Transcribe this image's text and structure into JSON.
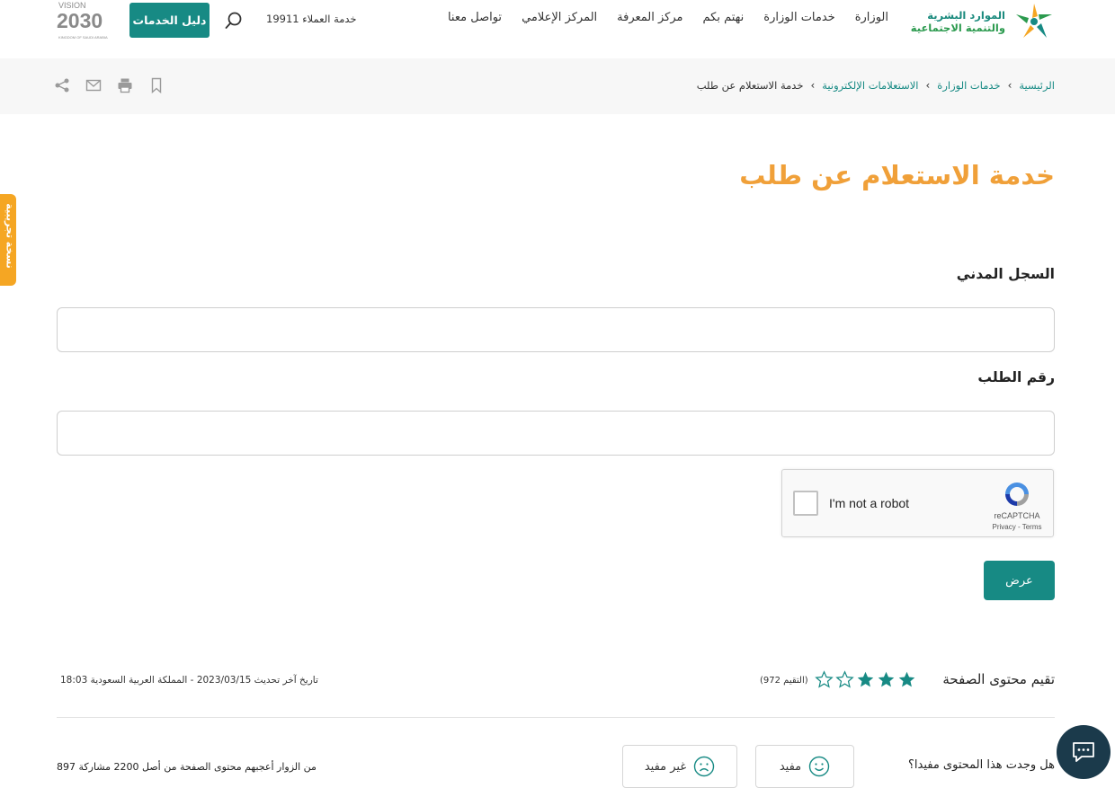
{
  "header": {
    "logo_line1": "الموارد البشرية",
    "logo_line2": "والتنمية الاجتماعية",
    "nav": [
      "الوزارة",
      "خدمات الوزارة",
      "نهتم بكم",
      "مركز المعرفة",
      "المركز الإعلامي",
      "تواصل معنا"
    ],
    "customer_service": "خدمة العملاء 19911",
    "services_guide": "دليل الخدمات",
    "vision_text": "VISION",
    "vision_year": "2030",
    "vision_sub": "KINGDOM OF SAUDI ARABIA"
  },
  "breadcrumb": {
    "items": [
      "الرئيسية",
      "خدمات الوزارة",
      "الاستعلامات الإلكترونية"
    ],
    "current": "خدمة الاستعلام عن طلب"
  },
  "side_tab": "نسخة تجريبية",
  "page_title": "خدمة الاستعلام عن طلب",
  "form": {
    "civil_label": "السجل المدني",
    "civil_value": "",
    "request_label": "رقم الطلب",
    "request_value": "",
    "captcha_text": "I'm not a robot",
    "captcha_brand": "reCAPTCHA",
    "captcha_terms": "Privacy - Terms",
    "submit": "عرض"
  },
  "rating": {
    "label": "تقيم محتوى الصفحة",
    "count": "(التقيم 972)",
    "stars_filled": 3,
    "stars_total": 5,
    "updated": "تاريخ آخر تحديث 2023/03/15 - المملكة العربية السعودية 18:03"
  },
  "feedback": {
    "question": "هل وجدت هذا المحتوى مفيدا؟",
    "useful": "مفيد",
    "not_useful": "غير مفيد",
    "visitors": "897 من الزوار أعجبهم محتوى الصفحة من أصل 2200 مشاركة"
  },
  "colors": {
    "primary": "#178a84",
    "accent": "#f0a039",
    "chat": "#1b3a4b"
  }
}
